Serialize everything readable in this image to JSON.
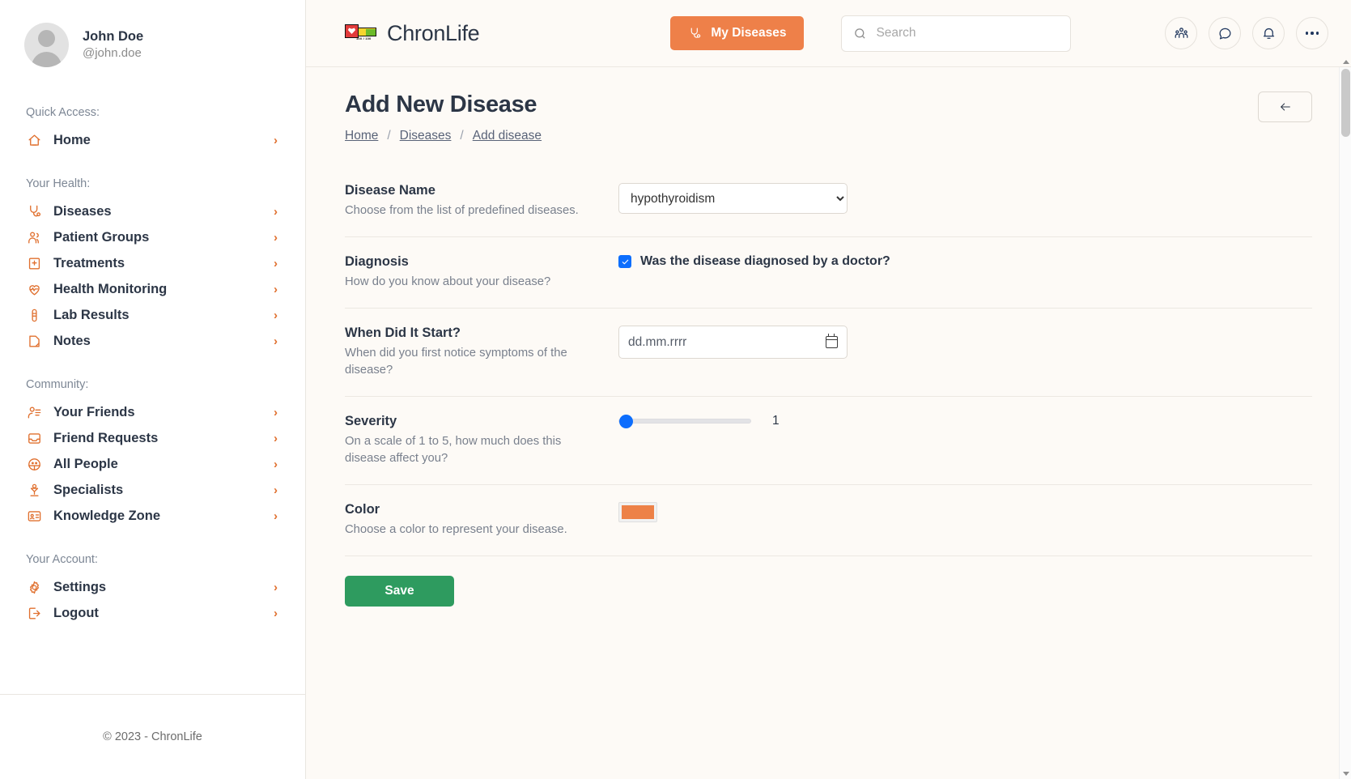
{
  "sidebar": {
    "profile": {
      "name": "John Doe",
      "handle": "@john.doe"
    },
    "sections": [
      {
        "title": "Quick Access:",
        "items": [
          {
            "label": "Home",
            "icon": "home-icon"
          }
        ]
      },
      {
        "title": "Your Health:",
        "items": [
          {
            "label": "Diseases",
            "icon": "stethoscope-icon"
          },
          {
            "label": "Patient Groups",
            "icon": "users-icon"
          },
          {
            "label": "Treatments",
            "icon": "hospital-icon"
          },
          {
            "label": "Health Monitoring",
            "icon": "heart-pulse-icon"
          },
          {
            "label": "Lab Results",
            "icon": "test-tube-icon"
          },
          {
            "label": "Notes",
            "icon": "note-icon"
          }
        ]
      },
      {
        "title": "Community:",
        "items": [
          {
            "label": "Your Friends",
            "icon": "user-list-icon"
          },
          {
            "label": "Friend Requests",
            "icon": "inbox-icon"
          },
          {
            "label": "All People",
            "icon": "globe-people-icon"
          },
          {
            "label": "Specialists",
            "icon": "doctor-icon"
          },
          {
            "label": "Knowledge Zone",
            "icon": "id-card-icon"
          }
        ]
      },
      {
        "title": "Your Account:",
        "items": [
          {
            "label": "Settings",
            "icon": "gear-icon"
          },
          {
            "label": "Logout",
            "icon": "logout-icon"
          }
        ]
      }
    ],
    "footer": "© 2023 - ChronLife"
  },
  "header": {
    "brand_name": "ChronLife",
    "logo_hp": "100 / 100",
    "my_diseases_label": "My Diseases",
    "search_placeholder": "Search",
    "search_value": "",
    "actions": [
      {
        "name": "people-icon"
      },
      {
        "name": "chat-icon"
      },
      {
        "name": "bell-icon"
      },
      {
        "name": "more-icon"
      }
    ]
  },
  "page": {
    "title": "Add New Disease",
    "breadcrumb": [
      "Home",
      "Diseases",
      "Add disease"
    ],
    "back_icon": "arrow-left-icon"
  },
  "form": {
    "disease_name": {
      "title": "Disease Name",
      "help": "Choose from the list of predefined diseases.",
      "value": "hypothyroidism",
      "options": [
        "hypothyroidism"
      ]
    },
    "diagnosis": {
      "title": "Diagnosis",
      "help": "How do you know about your disease?",
      "checkbox_label": "Was the disease diagnosed by a doctor?",
      "checked": true
    },
    "start": {
      "title": "When Did It Start?",
      "help": "When did you first notice symptoms of the disease?",
      "placeholder": "dd.mm.rrrr",
      "value": ""
    },
    "severity": {
      "title": "Severity",
      "help": "On a scale of 1 to 5, how much does this disease affect you?",
      "min": 1,
      "max": 5,
      "value": 1,
      "value_label": "1"
    },
    "color": {
      "title": "Color",
      "help": "Choose a color to represent your disease.",
      "value": "#ed8147"
    },
    "save_label": "Save"
  }
}
